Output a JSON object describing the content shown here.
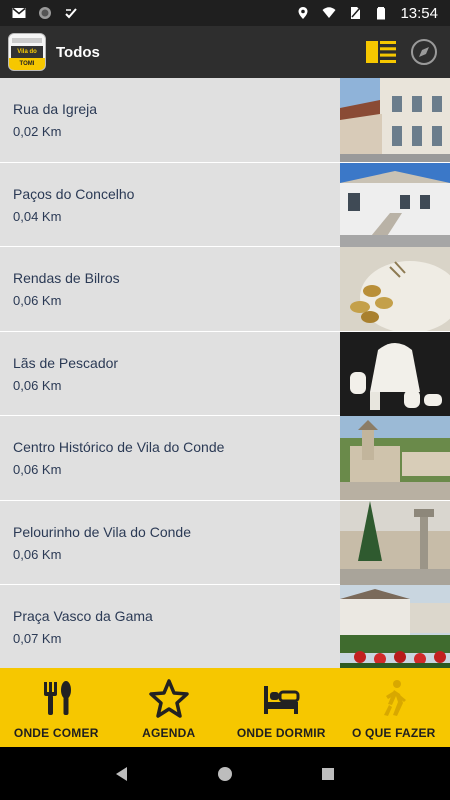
{
  "status_bar": {
    "time": "13:54",
    "icons": [
      "gmail-icon",
      "circle-icon",
      "download-done-icon",
      "location-icon",
      "wifi-icon",
      "no-sim-icon",
      "battery-icon"
    ]
  },
  "app_bar": {
    "logo_text": "Vila do Conde",
    "logo_badge": "TOMI",
    "title": "Todos",
    "actions": [
      "list-view-icon",
      "compass-icon"
    ],
    "accent_color": "#f6c700"
  },
  "items": [
    {
      "title": "Rua da Igreja",
      "distance": "0,02 Km"
    },
    {
      "title": "Paços do Concelho",
      "distance": "0,04 Km"
    },
    {
      "title": "Rendas de Bilros",
      "distance": "0,06 Km"
    },
    {
      "title": "Lãs de Pescador",
      "distance": "0,06 Km"
    },
    {
      "title": "Centro Histórico de Vila do Conde",
      "distance": "0,06 Km"
    },
    {
      "title": "Pelourinho de Vila do Conde",
      "distance": "0,06 Km"
    },
    {
      "title": "Praça Vasco da Gama",
      "distance": "0,07 Km"
    }
  ],
  "bottom_nav": {
    "items": [
      {
        "label": "ONDE COMER",
        "icon": "cutlery-icon"
      },
      {
        "label": "AGENDA",
        "icon": "star-icon"
      },
      {
        "label": "ONDE DORMIR",
        "icon": "bed-icon"
      },
      {
        "label": "O QUE FAZER",
        "icon": "walking-icon"
      }
    ]
  },
  "system_nav": [
    "back-icon",
    "home-icon",
    "recents-icon"
  ]
}
